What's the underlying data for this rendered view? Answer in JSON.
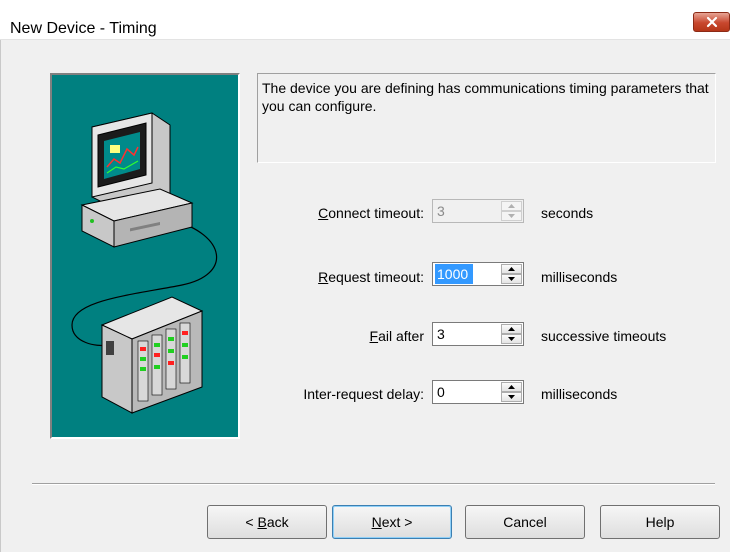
{
  "window": {
    "title": "New Device - Timing"
  },
  "description": "The device you are defining has communications timing parameters that you can configure.",
  "fields": [
    {
      "label": "Connect timeout:",
      "accesskey": "C",
      "label_rest": "onnect timeout:",
      "value": "3",
      "unit": "seconds",
      "enabled": false
    },
    {
      "label": "Request timeout:",
      "accesskey": "R",
      "label_rest": "equest timeout:",
      "value": "1000",
      "unit": "milliseconds",
      "enabled": true,
      "selected": true
    },
    {
      "label": "Fail after",
      "accesskey": "F",
      "label_rest": "ail after",
      "value": "3",
      "unit": "successive timeouts",
      "enabled": true
    },
    {
      "label": "Inter-request delay:",
      "accesskey": "",
      "label_rest": "Inter-request delay:",
      "value": "0",
      "unit": "milliseconds",
      "enabled": true
    }
  ],
  "buttons": {
    "back": {
      "prefix": "< ",
      "accesskey": "B",
      "rest": "ack"
    },
    "next": {
      "accesskey": "N",
      "rest": "ext >"
    },
    "cancel": "Cancel",
    "help": "Help"
  },
  "icons": {
    "close": "close-icon",
    "illustration": "computer-and-device-icon"
  },
  "colors": {
    "illustration_bg": "#008080",
    "close_button": "#c8472e",
    "selection": "#3399ff"
  }
}
